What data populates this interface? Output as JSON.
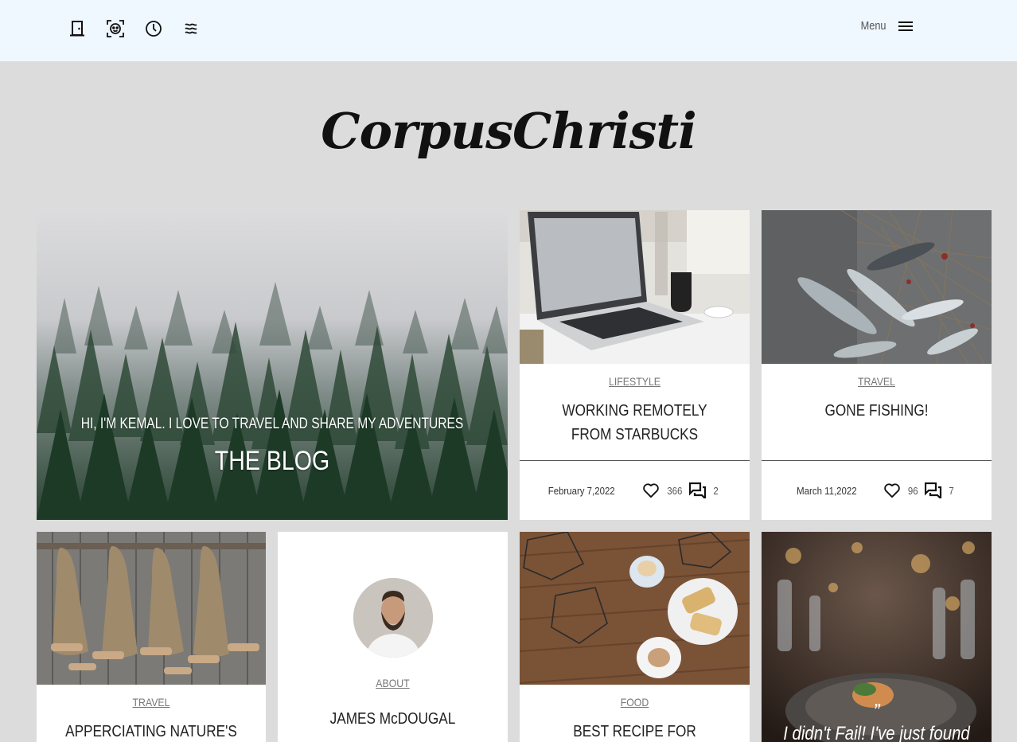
{
  "header": {
    "menu_label": "Menu"
  },
  "logo": {
    "text": "CorpusChristi"
  },
  "hero": {
    "subtitle": "HI, I'M KEMAL. I LOVE TO TRAVEL AND SHARE MY ADVENTURES",
    "title": "THE BLOG"
  },
  "posts": [
    {
      "category": "LIFESTYLE",
      "title": "WORKING REMOTELY FROM STARBUCKS",
      "date": "February 7,2022",
      "likes": "366",
      "comments": "2"
    },
    {
      "category": "TRAVEL",
      "title": "GONE FISHING!",
      "date": "March 11,2022",
      "likes": "96",
      "comments": "7"
    },
    {
      "category": "TRAVEL",
      "title": "APPERCIATING NATURE'S POWER ON"
    },
    {
      "category": "FOOD",
      "title": "BEST RECIPE FOR BREAKFAST WITH"
    }
  ],
  "about": {
    "label": "ABOUT",
    "name": "JAMES McDOUGAL"
  },
  "quote": {
    "mark": "”",
    "text": "I didn't Fail! I've just found"
  }
}
